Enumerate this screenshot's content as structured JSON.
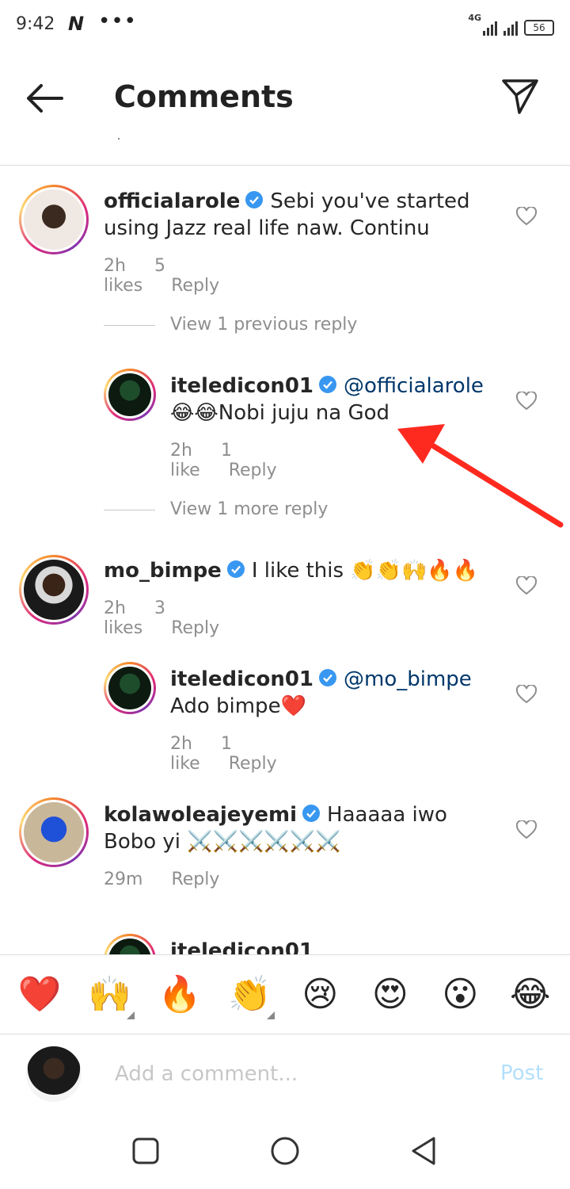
{
  "status_bar": {
    "time": "9:42",
    "notif": "N",
    "dots": "•••",
    "network": "4G",
    "battery": "56"
  },
  "header": {
    "title": "Comments",
    "back_icon": "back-arrow-icon",
    "share_icon": "paper-plane-icon"
  },
  "comments": [
    {
      "username": "officialarole",
      "verified": true,
      "text": "Sebi you've started using Jazz real life naw. Continu",
      "time": "2h",
      "likes": "5 likes",
      "reply": "Reply"
    },
    {
      "view_replies": "View 1 previous reply"
    },
    {
      "username": "iteledicon01",
      "verified": true,
      "mention": "@officialarole",
      "text": "😂😂Nobi juju na God",
      "time": "2h",
      "likes": "1 like",
      "reply": "Reply"
    },
    {
      "view_replies": "View 1 more reply"
    },
    {
      "username": "mo_bimpe",
      "verified": true,
      "text": "I like this 👏👏🙌🔥🔥",
      "time": "2h",
      "likes": "3 likes",
      "reply": "Reply"
    },
    {
      "username": "iteledicon01",
      "verified": true,
      "mention": "@mo_bimpe",
      "text": "Ado bimpe❤️",
      "time": "2h",
      "likes": "1 like",
      "reply": "Reply"
    },
    {
      "username": "kolawoleajeyemi",
      "verified": true,
      "text": "Haaaaa iwo Bobo yi ⚔️⚔️⚔️⚔️⚔️⚔️",
      "time": "29m",
      "reply": "Reply"
    },
    {
      "username": "iteledicon01"
    }
  ],
  "reactions": [
    "❤️",
    "🙌",
    "🔥",
    "👏",
    "😢",
    "😍",
    "😮",
    "😂"
  ],
  "composer": {
    "placeholder": "Add a comment...",
    "post_label": "Post"
  },
  "colors": {
    "annotation_arrow": "#ff2a1f",
    "verified": "#3897f0",
    "mention": "#00376b",
    "post": "#b2dffc"
  }
}
